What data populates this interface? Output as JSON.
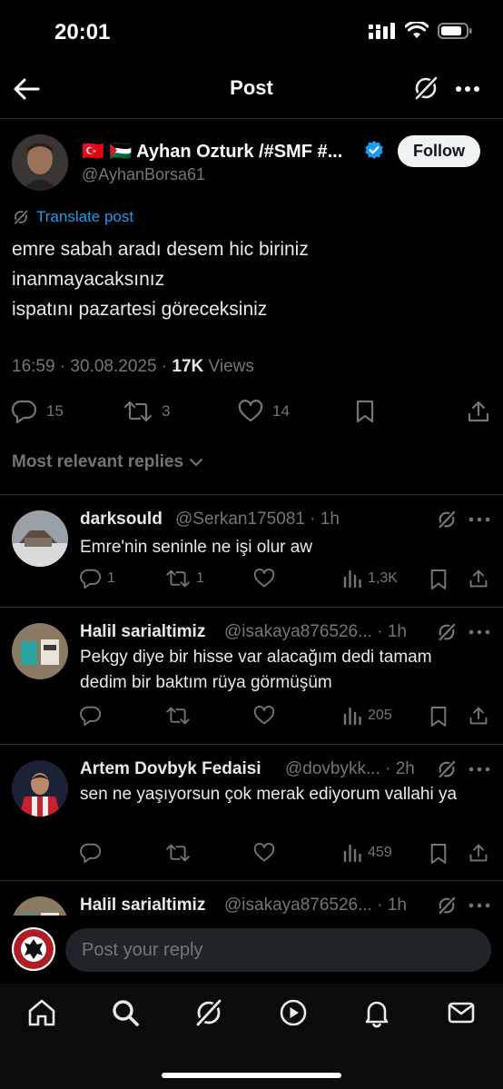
{
  "status_bar": {
    "time": "20:01"
  },
  "header": {
    "title": "Post"
  },
  "post": {
    "author_name": "🇹🇷 🇵🇸 Ayhan Ozturk /#SMF #...",
    "author_handle": "@AyhanBorsa61",
    "follow_label": "Follow",
    "translate_label": "Translate post",
    "text_lines": [
      "emre sabah aradı desem hic biriniz",
      "inanmayacaksınız",
      "ispatını pazartesi göreceksiniz"
    ],
    "timestamp": "16:59 · 30.08.2025 · ",
    "views_count": "17K",
    "views_label": " Views",
    "replies": "15",
    "reposts": "3",
    "likes": "14"
  },
  "replies_filter": "Most relevant replies",
  "replies": [
    {
      "name": "darksould",
      "handle": "@Serkan175081 · 1h",
      "text": "Emre'nin seninle ne işi olur aw",
      "reply_count": "1",
      "repost_count": "1",
      "like_count": "",
      "views": "1,3K"
    },
    {
      "name": "Halil sarialtimiz",
      "handle": "@isakaya876526... · 1h",
      "text": "Pekgy diye bir hisse var alacağım dedi tamam dedim bir baktım rüya görmüşüm",
      "reply_count": "",
      "repost_count": "",
      "like_count": "",
      "views": "205"
    },
    {
      "name": "Artem Dovbyk Fedaisi",
      "handle": "@dovbykk... · 2h",
      "text": "sen ne yaşıyorsun çok merak ediyorum vallahi ya",
      "reply_count": "",
      "repost_count": "",
      "like_count": "",
      "views": "459"
    },
    {
      "name": "Halil sarialtimiz",
      "handle": "@isakaya876526... · 1h"
    }
  ],
  "compose": {
    "placeholder": "Post your reply"
  },
  "colors": {
    "accent": "#1d9bf0",
    "muted": "#71767b",
    "background": "#000000"
  }
}
